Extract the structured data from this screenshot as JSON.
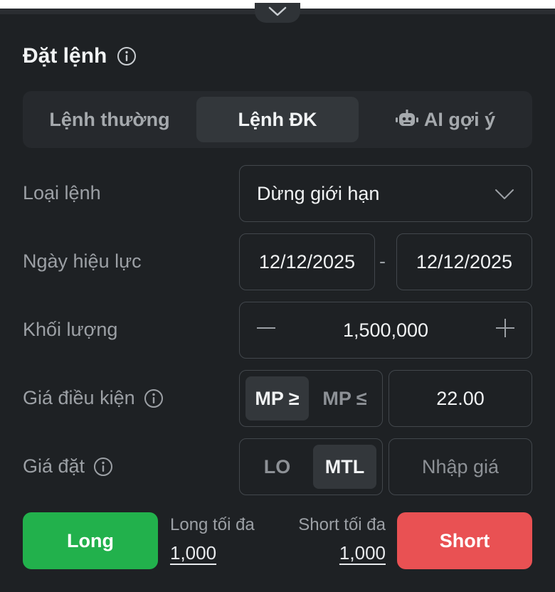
{
  "panel": {
    "title": "Đặt lệnh"
  },
  "tabs": [
    {
      "label": "Lệnh thường",
      "active": false
    },
    {
      "label": "Lệnh ĐK",
      "active": true
    },
    {
      "label": "AI gợi ý",
      "active": false,
      "icon": "robot-icon"
    }
  ],
  "form": {
    "order_type": {
      "label": "Loại lệnh",
      "value": "Dừng giới hạn"
    },
    "effective_date": {
      "label": "Ngày hiệu lực",
      "from": "12/12/2025",
      "separator": "-",
      "to": "12/12/2025"
    },
    "quantity": {
      "label": "Khối lượng",
      "value": "1,500,000"
    },
    "condition_price": {
      "label": "Giá điều kiện",
      "options": [
        "MP ≥",
        "MP ≤"
      ],
      "selected": "MP ≥",
      "value": "22.00"
    },
    "order_price": {
      "label": "Giá đặt",
      "options": [
        "LO",
        "MTL"
      ],
      "selected": "MTL",
      "placeholder": "Nhập giá"
    }
  },
  "actions": {
    "long_label": "Long",
    "short_label": "Short",
    "long_max_label": "Long tối đa",
    "long_max_value": "1,000",
    "short_max_label": "Short tối đa",
    "short_max_value": "1,000"
  },
  "colors": {
    "long": "#22b14c",
    "short": "#e95153",
    "background": "#1e2124"
  }
}
